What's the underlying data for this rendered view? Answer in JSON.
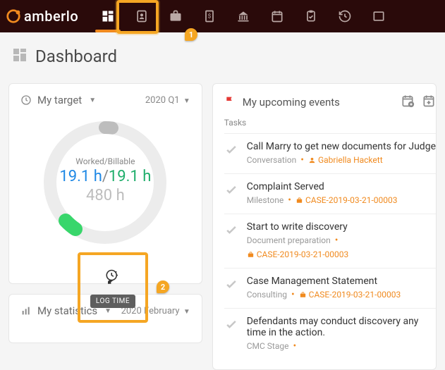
{
  "brand": {
    "name": "amberlo"
  },
  "nav": {
    "items": [
      {
        "name": "dashboard-icon",
        "active": true
      },
      {
        "name": "contacts-icon"
      },
      {
        "name": "matters-icon"
      },
      {
        "name": "billing-icon"
      },
      {
        "name": "bank-icon"
      },
      {
        "name": "calendar-icon"
      },
      {
        "name": "tasks-icon"
      },
      {
        "name": "history-icon"
      },
      {
        "name": "more-icon"
      }
    ]
  },
  "callouts": {
    "one": "1",
    "two": "2"
  },
  "page": {
    "title": "Dashboard"
  },
  "target": {
    "card_title": "My target",
    "period": "2020 Q1",
    "worked_billable_label": "Worked/Billable",
    "worked": "19.1 h",
    "billable": "19.1 h",
    "total": "480 h",
    "log_time_label": "LOG TIME"
  },
  "stats": {
    "card_title": "My statistics",
    "period": "2020 February"
  },
  "events": {
    "card_title": "My upcoming events",
    "tasks_label": "Tasks",
    "items": [
      {
        "title": "Call Marry to get new documents for Judge",
        "type": "Conversation",
        "assignee": "Gabriella Hackett",
        "case": null
      },
      {
        "title": "Complaint Served",
        "type": "Milestone",
        "assignee": null,
        "case": "CASE-2019-03-21-00003"
      },
      {
        "title": "Start to write discovery",
        "type": "Document preparation",
        "assignee": null,
        "case": "CASE-2019-03-21-00003"
      },
      {
        "title": "Case Management Statement",
        "type": "Consulting",
        "assignee": null,
        "case": "CASE-2019-03-21-00003"
      },
      {
        "title": "Defendants may conduct discovery any time in the action.",
        "type": "CMC Stage",
        "assignee": null,
        "case": null
      }
    ]
  }
}
